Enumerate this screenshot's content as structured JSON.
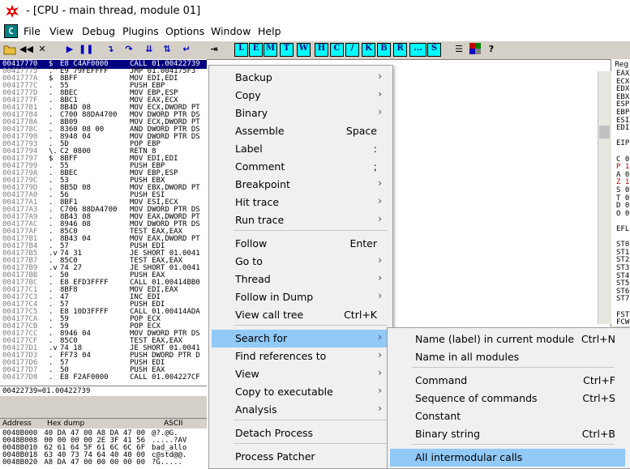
{
  "window": {
    "title": "- [CPU - main thread, module 01]"
  },
  "menubar": {
    "app_icon": "C",
    "items": [
      "File",
      "View",
      "Debug",
      "Plugins",
      "Options",
      "Window",
      "Help"
    ]
  },
  "toolbar": {
    "letters": [
      "L",
      "E",
      "M",
      "T",
      "W",
      "H",
      "C",
      "/",
      "K",
      "B",
      "R",
      "...",
      "S"
    ]
  },
  "disasm": {
    "rows": [
      {
        "addr": "00417770",
        "mk": "$",
        "hex": "E8 C4AF0000",
        "ins": "CALL 01.00422739"
      },
      {
        "addr": "00417775",
        "mk": ".^",
        "hex": "E9 79FEFFFF",
        "ins": "JMP 01.004175F3"
      },
      {
        "addr": "0041777A",
        "mk": "$",
        "hex": "8BFF",
        "ins": "MOV EDI,EDI"
      },
      {
        "addr": "0041777C",
        "mk": ".",
        "hex": "55",
        "ins": "PUSH EBP"
      },
      {
        "addr": "0041777D",
        "mk": ".",
        "hex": "8BEC",
        "ins": "MOV EBP,ESP"
      },
      {
        "addr": "0041777F",
        "mk": ".",
        "hex": "8BC1",
        "ins": "MOV EAX,ECX"
      },
      {
        "addr": "00417781",
        "mk": ".",
        "hex": "8B4D 08",
        "ins": "MOV ECX,DWORD PT"
      },
      {
        "addr": "00417784",
        "mk": ".",
        "hex": "C700 88DA4700",
        "ins": "MOV DWORD PTR DS"
      },
      {
        "addr": "0041778A",
        "mk": ".",
        "hex": "8B09",
        "ins": "MOV ECX,DWORD PT"
      },
      {
        "addr": "0041778C",
        "mk": ".",
        "hex": "8360 08 00",
        "ins": "AND DWORD PTR DS"
      },
      {
        "addr": "00417790",
        "mk": ".",
        "hex": "8948 04",
        "ins": "MOV DWORD PTR DS"
      },
      {
        "addr": "00417793",
        "mk": ".",
        "hex": "5D",
        "ins": "POP EBP"
      },
      {
        "addr": "00417794",
        "mk": "\\.",
        "hex": "C2 0800",
        "ins": "RETN 8"
      },
      {
        "addr": "00417797",
        "mk": "$",
        "hex": "8BFF",
        "ins": "MOV EDI,EDI"
      },
      {
        "addr": "00417799",
        "mk": ".",
        "hex": "55",
        "ins": "PUSH EBP"
      },
      {
        "addr": "0041779A",
        "mk": ".",
        "hex": "8BEC",
        "ins": "MOV EBP,ESP"
      },
      {
        "addr": "0041779C",
        "mk": ".",
        "hex": "53",
        "ins": "PUSH EBX"
      },
      {
        "addr": "0041779D",
        "mk": ".",
        "hex": "8B5D 08",
        "ins": "MOV EBX,DWORD PT"
      },
      {
        "addr": "004177A0",
        "mk": ".",
        "hex": "56",
        "ins": "PUSH ESI"
      },
      {
        "addr": "004177A1",
        "mk": ".",
        "hex": "8BF1",
        "ins": "MOV ESI,ECX"
      },
      {
        "addr": "004177A3",
        "mk": ".",
        "hex": "C706 88DA4700",
        "ins": "MOV DWORD PTR DS"
      },
      {
        "addr": "004177A9",
        "mk": ".",
        "hex": "8B43 08",
        "ins": "MOV EAX,DWORD PT"
      },
      {
        "addr": "004177AC",
        "mk": ".",
        "hex": "8946 08",
        "ins": "MOV DWORD PTR DS"
      },
      {
        "addr": "004177AF",
        "mk": ".",
        "hex": "85C0",
        "ins": "TEST EAX,EAX"
      },
      {
        "addr": "004177B1",
        "mk": ".",
        "hex": "8B43 04",
        "ins": "MOV EAX,DWORD PT"
      },
      {
        "addr": "004177B4",
        "mk": ".",
        "hex": "57",
        "ins": "PUSH EDI"
      },
      {
        "addr": "004177B5",
        "mk": ".v",
        "hex": "74 31",
        "ins": "JE SHORT 01.0041"
      },
      {
        "addr": "004177B7",
        "mk": ".",
        "hex": "85C0",
        "ins": "TEST EAX,EAX"
      },
      {
        "addr": "004177B9",
        "mk": ".v",
        "hex": "74 27",
        "ins": "JE SHORT 01.0041"
      },
      {
        "addr": "004177BB",
        "mk": ".",
        "hex": "50",
        "ins": "PUSH EAX"
      },
      {
        "addr": "004177BC",
        "mk": ".",
        "hex": "E8 EFD3FFFF",
        "ins": "CALL 01.00414BB0"
      },
      {
        "addr": "004177C1",
        "mk": ".",
        "hex": "8BF8",
        "ins": "MOV EDI,EAX"
      },
      {
        "addr": "004177C3",
        "mk": ".",
        "hex": "47",
        "ins": "INC EDI"
      },
      {
        "addr": "004177C4",
        "mk": ".",
        "hex": "57",
        "ins": "PUSH EDI"
      },
      {
        "addr": "004177C5",
        "mk": ".",
        "hex": "E8 10D3FFFF",
        "ins": "CALL 01.00414ADA"
      },
      {
        "addr": "004177CA",
        "mk": ".",
        "hex": "59",
        "ins": "POP ECX"
      },
      {
        "addr": "004177CB",
        "mk": ".",
        "hex": "59",
        "ins": "POP ECX"
      },
      {
        "addr": "004177CC",
        "mk": ".",
        "hex": "8946 04",
        "ins": "MOV DWORD PTR DS"
      },
      {
        "addr": "004177CF",
        "mk": ".",
        "hex": "85C0",
        "ins": "TEST EAX,EAX"
      },
      {
        "addr": "004177D1",
        "mk": ".v",
        "hex": "74 18",
        "ins": "JE SHORT 01.0041"
      },
      {
        "addr": "004177D3",
        "mk": ".",
        "hex": "FF73 04",
        "ins": "PUSH DWORD PTR D"
      },
      {
        "addr": "004177D6",
        "mk": ".",
        "hex": "57",
        "ins": "PUSH EDI"
      },
      {
        "addr": "004177D7",
        "mk": ".",
        "hex": "50",
        "ins": "PUSH EAX"
      },
      {
        "addr": "004177D8",
        "mk": ".",
        "hex": "E8 F2AF0000",
        "ins": "CALL 01.004227CF"
      }
    ],
    "status": "00422739=01.00422739"
  },
  "dump": {
    "col_address": "Address",
    "col_hex": "Hex dump",
    "col_ascii": "ASCII",
    "rows": [
      {
        "addr": "0048B000",
        "hex": "40 DA 47 00 A8 DA 47 00",
        "ascii": "@?.@G."
      },
      {
        "addr": "0048B008",
        "hex": "00 00 00 00 2E 3F 41 56",
        "ascii": ".....?AV"
      },
      {
        "addr": "0048B010",
        "hex": "62 61 64 5F 61 6C 6C 6F",
        "ascii": "bad_allo"
      },
      {
        "addr": "0048B018",
        "hex": "63 40 73 74 64 40 40 00",
        "ascii": "c@std@@."
      },
      {
        "addr": "0048B020",
        "hex": "A8 DA 47 00 00 00 00 00",
        "ascii": "?G....."
      }
    ]
  },
  "registers": {
    "header": "Reg",
    "lines": [
      "EAX",
      "ECX",
      "EDX",
      "EBX",
      "ESP",
      "EBP",
      "ESI",
      "EDI",
      "",
      "EIP",
      "",
      "C 0",
      "P 1",
      "A 0",
      "Z 1",
      "S 0",
      "T 0",
      "D 0",
      "O 0",
      "",
      "EFL",
      "",
      "ST0",
      "ST1",
      "ST2",
      "ST3",
      "ST4",
      "ST5",
      "ST6",
      "ST7",
      "",
      "FST",
      "FCW"
    ]
  },
  "context_menu": {
    "items": [
      {
        "label": "Backup",
        "shortcut": "",
        "submenu": true
      },
      {
        "label": "Copy",
        "shortcut": "",
        "submenu": true
      },
      {
        "label": "Binary",
        "shortcut": "",
        "submenu": true
      },
      {
        "label": "Assemble",
        "shortcut": "Space",
        "submenu": false
      },
      {
        "label": "Label",
        "shortcut": ":",
        "submenu": false
      },
      {
        "label": "Comment",
        "shortcut": ";",
        "submenu": false
      },
      {
        "label": "Breakpoint",
        "shortcut": "",
        "submenu": true
      },
      {
        "label": "Hit trace",
        "shortcut": "",
        "submenu": true
      },
      {
        "label": "Run trace",
        "shortcut": "",
        "submenu": true
      },
      {
        "label": "Follow",
        "shortcut": "Enter",
        "submenu": false
      },
      {
        "label": "Go to",
        "shortcut": "",
        "submenu": true
      },
      {
        "label": "Thread",
        "shortcut": "",
        "submenu": true
      },
      {
        "label": "Follow in Dump",
        "shortcut": "",
        "submenu": true
      },
      {
        "label": "View call tree",
        "shortcut": "Ctrl+K",
        "submenu": false
      },
      {
        "label": "Search for",
        "shortcut": "",
        "submenu": true,
        "highlighted": true
      },
      {
        "label": "Find references to",
        "shortcut": "",
        "submenu": true
      },
      {
        "label": "View",
        "shortcut": "",
        "submenu": true
      },
      {
        "label": "Copy to executable",
        "shortcut": "",
        "submenu": true
      },
      {
        "label": "Analysis",
        "shortcut": "",
        "submenu": true
      },
      {
        "label": "Detach Process",
        "shortcut": "",
        "submenu": false
      },
      {
        "label": "Process Patcher",
        "shortcut": "",
        "submenu": false
      }
    ]
  },
  "search_submenu": {
    "items": [
      {
        "label": "Name (label) in current module",
        "shortcut": "Ctrl+N"
      },
      {
        "label": "Name in all modules",
        "shortcut": ""
      },
      {
        "label": "Command",
        "shortcut": "Ctrl+F"
      },
      {
        "label": "Sequence of commands",
        "shortcut": "Ctrl+S"
      },
      {
        "label": "Constant",
        "shortcut": ""
      },
      {
        "label": "Binary string",
        "shortcut": "Ctrl+B"
      },
      {
        "label": "All intermodular calls",
        "shortcut": "",
        "highlighted": true
      }
    ]
  },
  "colors": {
    "menu_highlight": "#91c9f7",
    "selection": "#000080",
    "toolbar_letters": "#00ffff",
    "app_icon": "#008080"
  }
}
